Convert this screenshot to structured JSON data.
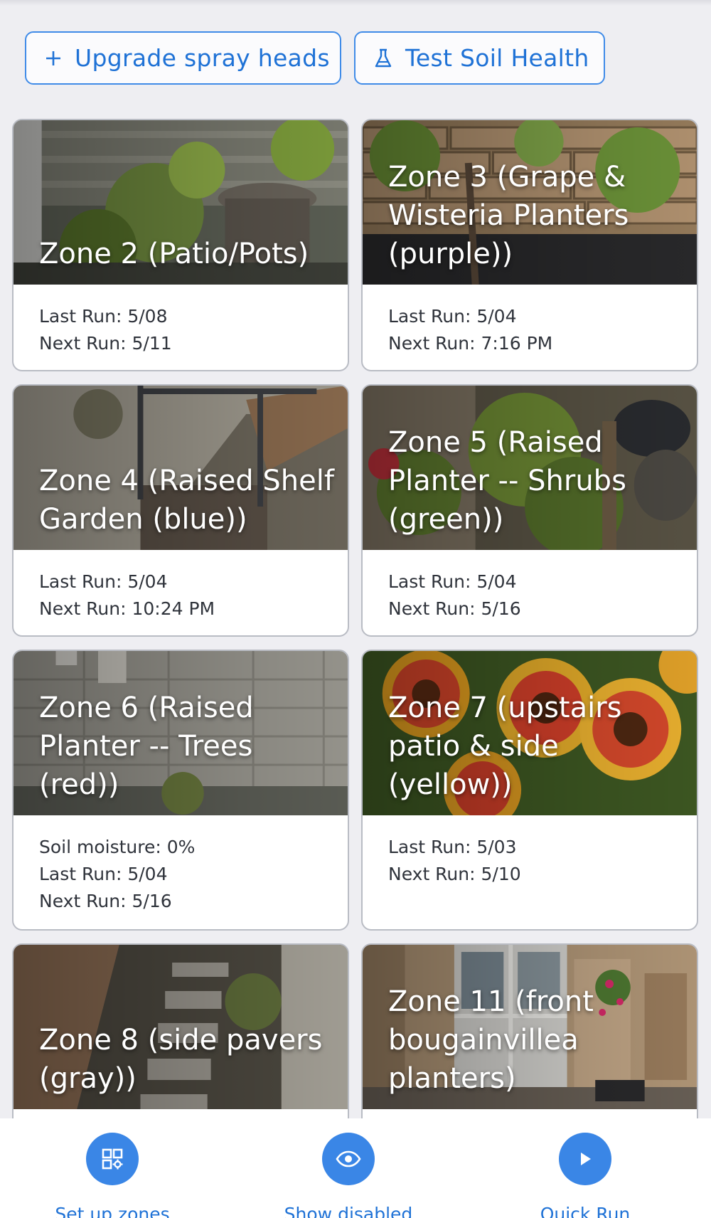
{
  "actions": {
    "upgrade_label": "Upgrade spray heads",
    "soil_label": "Test Soil Health"
  },
  "zones": [
    {
      "title": "Zone 2 (Patio/Pots)",
      "lines": [
        "Last Run: 5/08",
        "Next Run: 5/11"
      ]
    },
    {
      "title": "Zone 3 (Grape & Wisteria Planters (purple))",
      "lines": [
        "Last Run: 5/04",
        "Next Run: 7:16 PM"
      ]
    },
    {
      "title": "Zone 4 (Raised Shelf Garden (blue))",
      "lines": [
        "Last Run: 5/04",
        "Next Run: 10:24 PM"
      ]
    },
    {
      "title": "Zone 5 (Raised Planter -- Shrubs (green))",
      "lines": [
        "Last Run: 5/04",
        "Next Run: 5/16"
      ]
    },
    {
      "title": "Zone 6 (Raised Planter -- Trees (red))",
      "lines": [
        "Soil moisture: 0%",
        "Last Run: 5/04",
        "Next Run: 5/16"
      ]
    },
    {
      "title": "Zone 7 (upstairs patio & side (yellow))",
      "lines": [
        "Last Run: 5/03",
        "Next Run: 5/10"
      ]
    },
    {
      "title": "Zone 8 (side pavers (gray))",
      "lines": []
    },
    {
      "title": "Zone 11 (front bougainvillea planters)",
      "lines": []
    }
  ],
  "bottom_nav": {
    "setup_label": "Set up zones",
    "disabled_label": "Show disabled",
    "quickrun_label": "Quick Run"
  },
  "icons": {
    "upgrade": "plus-icon",
    "soil": "flask-icon",
    "setup": "zones-grid-icon",
    "disabled": "eye-icon",
    "quickrun": "play-icon"
  },
  "colors": {
    "accent": "#3a86e6",
    "accent_text": "#1f72d6",
    "background": "#eeeef2"
  }
}
